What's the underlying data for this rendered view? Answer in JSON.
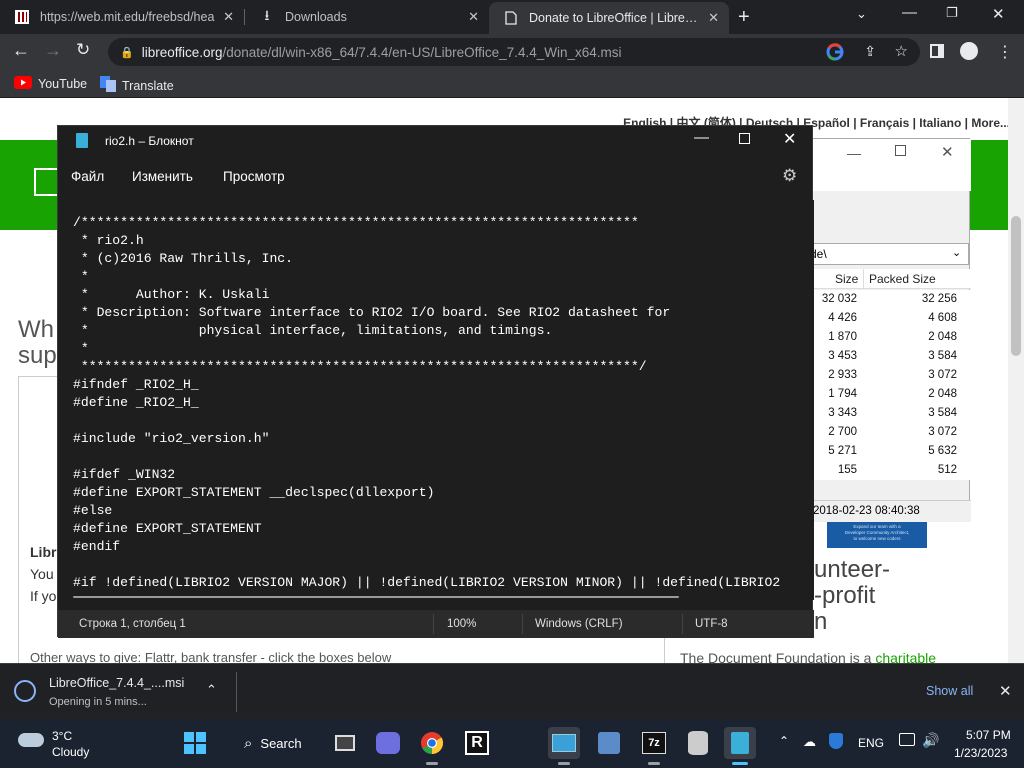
{
  "browser": {
    "tabs": [
      {
        "title": "https://web.mit.edu/freebsd/hea",
        "icon": "pdf-document-icon"
      },
      {
        "title": "Downloads",
        "icon": "download-icon"
      },
      {
        "title": "Donate to LibreOffice | LibreOffic",
        "icon": "page-icon"
      }
    ],
    "url_host": "libreoffice.org",
    "url_path": "/donate/dl/win-x86_64/7.4.4/en-US/LibreOffice_7.4.4_Win_x64.msi",
    "bookmarks": [
      {
        "label": "YouTube"
      },
      {
        "label": "Translate"
      }
    ]
  },
  "page": {
    "languages": "English | 中文 (简体) | Deutsch | Español | Français | Italiano | More...",
    "heading_frag1": "Wh",
    "heading_frag2": "sup",
    "left_frag1": "Libr",
    "left_frag2": "You",
    "left_frag3": "If yo",
    "right_frag1": "unteer-",
    "right_frag2": "-profit",
    "right_frag3": "n",
    "bottom_left": "Other ways to give: Flattr, bank transfer - click the boxes below",
    "bottom_right_prefix": "The Document Foundation is a ",
    "bottom_right_link": "charitable",
    "banner_line1": "Expand our team with a",
    "banner_line2": "Developer Community Architect,",
    "banner_line3": "to welcome new coders",
    "accent_color": "#18a303"
  },
  "sevenzip": {
    "path": "de\\",
    "col_size": "Size",
    "col_packed": "Packed Size",
    "rows": [
      {
        "size": "32 032",
        "packed": "32 256"
      },
      {
        "size": "4 426",
        "packed": "4 608"
      },
      {
        "size": "1 870",
        "packed": "2 048"
      },
      {
        "size": "3 453",
        "packed": "3 584"
      },
      {
        "size": "2 933",
        "packed": "3 072"
      },
      {
        "size": "1 794",
        "packed": "2 048"
      },
      {
        "size": "3 343",
        "packed": "3 584"
      },
      {
        "size": "2 700",
        "packed": "3 072"
      },
      {
        "size": "5 271",
        "packed": "5 632"
      },
      {
        "size": "155",
        "packed": "512"
      }
    ],
    "status": "2018-02-23 08:40:38"
  },
  "notepad": {
    "title": "rio2.h – Блокнот",
    "menu": [
      "Файл",
      "Изменить",
      "Просмотр"
    ],
    "code": "/***********************************************************************\n * rio2.h\n * (c)2016 Raw Thrills, Inc.\n *\n *      Author: K. Uskali\n * Description: Software interface to RIO2 I/O board. See RIO2 datasheet for\n *              physical interface, limitations, and timings.\n *\n ***********************************************************************/\n#ifndef _RIO2_H_\n#define _RIO2_H_\n\n#include \"rio2_version.h\"\n\n#ifdef _WIN32\n#define EXPORT_STATEMENT __declspec(dllexport)\n#else\n#define EXPORT_STATEMENT\n#endif\n\n#if !defined(LIBRIO2 VERSION MAJOR) || !defined(LIBRIO2 VERSION MINOR) || !defined(LIBRIO2",
    "status": {
      "position": "Строка 1, столбец 1",
      "zoom": "100%",
      "line_ending": "Windows (CRLF)",
      "encoding": "UTF-8"
    }
  },
  "download": {
    "filename": "LibreOffice_7.4.4_....msi",
    "status": "Opening in 5 mins...",
    "show_all": "Show all"
  },
  "taskbar": {
    "weather_temp": "3°C",
    "weather_desc": "Cloudy",
    "search_label": "Search",
    "language": "ENG",
    "time": "5:07 PM",
    "date": "1/23/2023"
  }
}
